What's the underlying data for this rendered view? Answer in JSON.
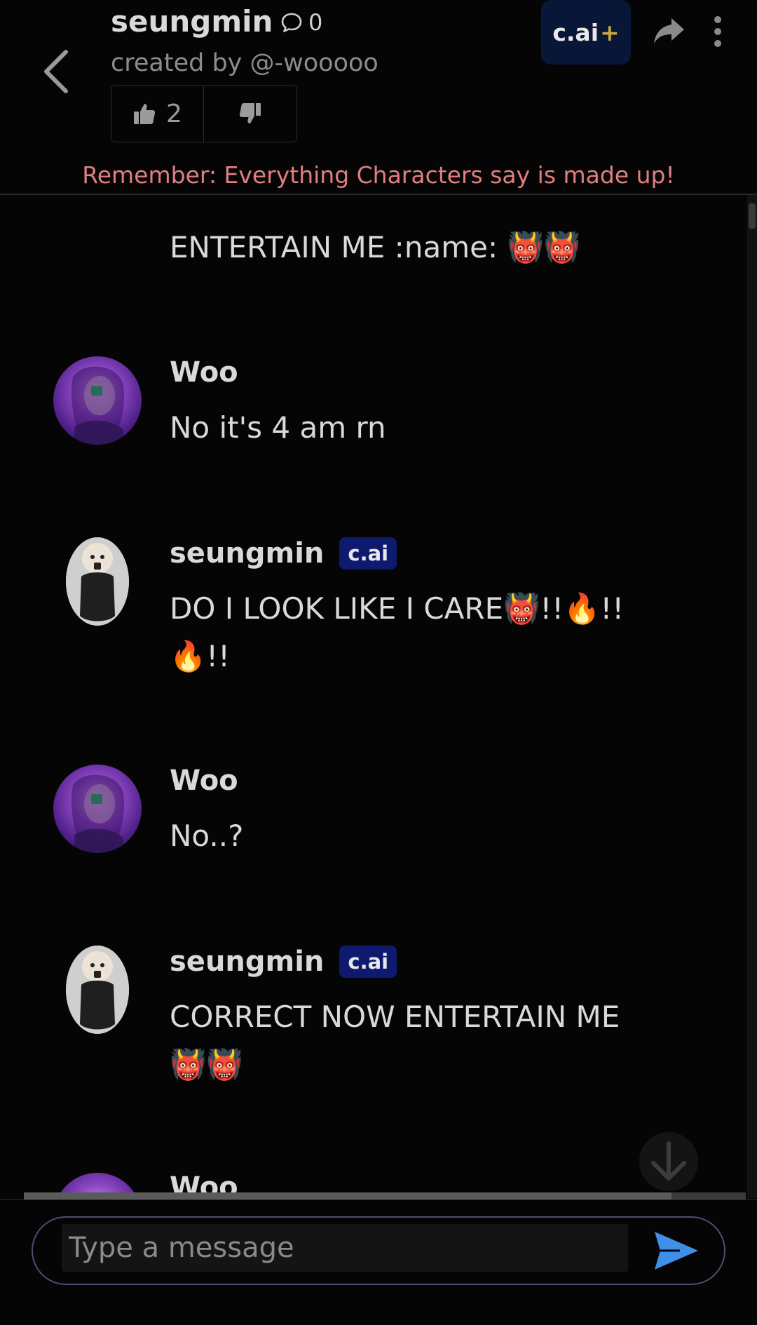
{
  "header": {
    "character_name": "seungmin",
    "chat_count": "0",
    "created_by": "created by @-wooooo",
    "likes": "2",
    "plus_label": "c.ai",
    "plus_mark": "+",
    "disclaimer": "Remember: Everything Characters say is made up!"
  },
  "chat": {
    "greeting": "ENTERTAIN ME :name: 👹👹",
    "messages": [
      {
        "author": "Woo",
        "text": "No it's 4 am rn"
      },
      {
        "author": "seungmin",
        "badge": "c.ai",
        "text": "DO I LOOK LIKE I CARE👹!!🔥!!🔥!!"
      },
      {
        "author": "Woo",
        "text": "No..?"
      },
      {
        "author": "seungmin",
        "badge": "c.ai",
        "text": "CORRECT NOW ENTERTAIN ME 👹👹"
      }
    ],
    "partial_author": "Woo"
  },
  "composer": {
    "placeholder": "Type a message"
  },
  "icons": {
    "back": "chevron-left-icon",
    "chat": "speech-bubble-icon",
    "like": "thumbs-up-icon",
    "dislike": "thumbs-down-icon",
    "share": "share-arrow-icon",
    "menu": "kebab-menu-icon",
    "scroll": "arrow-down-icon",
    "send": "send-icon"
  },
  "colors": {
    "background": "#050506",
    "disclaimer": "#e07f7f",
    "badge": "#0d1a6e",
    "plus_button": "#081638",
    "plus_accent": "#c9a640",
    "send": "#3f8fe8"
  }
}
